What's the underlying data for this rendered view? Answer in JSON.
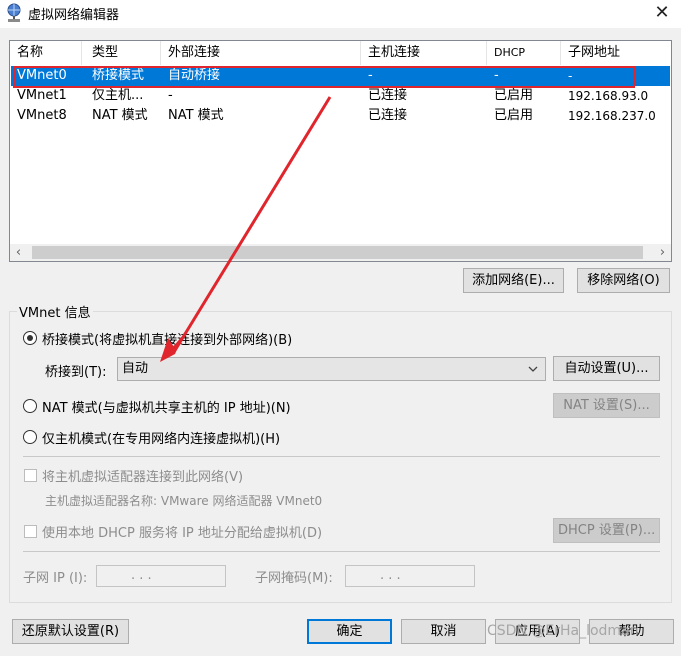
{
  "window": {
    "title": "虚拟网络编辑器",
    "close_glyph": "✕"
  },
  "table": {
    "columns": [
      "名称",
      "类型",
      "外部连接",
      "主机连接",
      "DHCP",
      "子网地址"
    ],
    "rows": [
      [
        "VMnet0",
        "桥接模式",
        "自动桥接",
        "-",
        "-",
        "-"
      ],
      [
        "VMnet1",
        "仅主机...",
        "-",
        "已连接",
        "已启用",
        "192.168.93.0"
      ],
      [
        "VMnet8",
        "NAT 模式",
        "NAT 模式",
        "已连接",
        "已启用",
        "192.168.237.0"
      ]
    ],
    "selected_row": 0
  },
  "list_buttons": {
    "add": "添加网络(E)...",
    "remove": "移除网络(O)"
  },
  "vmnet_info": {
    "group_label": "VMnet 信息",
    "bridged_label": "桥接模式(将虚拟机直接连接到外部网络)(B)",
    "bridge_to_label": "桥接到(T):",
    "bridge_to_value": "自动",
    "auto_settings": "自动设置(U)...",
    "nat_label": "NAT 模式(与虚拟机共享主机的 IP 地址)(N)",
    "nat_settings": "NAT 设置(S)...",
    "hostonly_label": "仅主机模式(在专用网络内连接虚拟机)(H)",
    "connect_adapter_label": "将主机虚拟适配器连接到此网络(V)",
    "adapter_name_label": "主机虚拟适配器名称: VMware 网络适配器 VMnet0",
    "dhcp_label": "使用本地 DHCP 服务将 IP 地址分配给虚拟机(D)",
    "dhcp_settings": "DHCP 设置(P)...",
    "subnet_ip_label": "子网 IP (I):",
    "subnet_mask_label": "子网掩码(M):",
    "ip_dots": ". . ."
  },
  "footer": {
    "restore": "还原默认设置(R)",
    "ok": "确定",
    "cancel": "取消",
    "apply": "应用(A)",
    "help": "帮助"
  },
  "watermark": "CSDN @ErHa_lodman",
  "colors": {
    "selection": "#0078d7",
    "annotation": "#e0262c"
  }
}
